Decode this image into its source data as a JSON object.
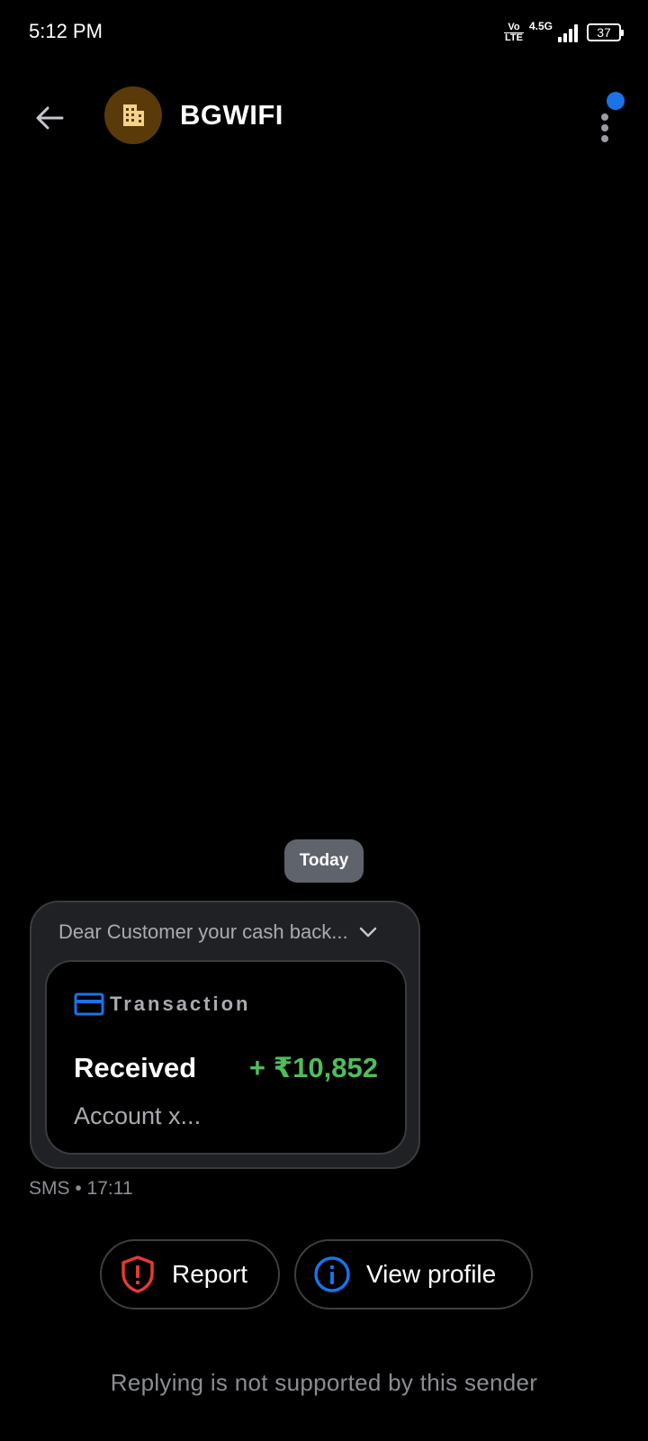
{
  "status_bar": {
    "time": "5:12 PM",
    "volte_top": "Vo",
    "volte_bottom": "LTE",
    "network": "4.5G",
    "battery": "37"
  },
  "header": {
    "back_icon": "arrow-left-icon",
    "avatar_icon": "building-icon",
    "avatar_color": "#5b3a0a",
    "sender_name": "BGWIFI",
    "more_icon": "more-vertical-icon",
    "notification_color": "#1a73e8"
  },
  "conversation": {
    "date_chip": "Today",
    "message": {
      "preview": "Dear Customer your cash back...",
      "expand_icon": "chevron-down-icon",
      "transaction": {
        "label": "Transaction",
        "icon": "credit-card-icon",
        "status": "Received",
        "amount": "+ ₹10,852",
        "account": "Account x...",
        "amount_color": "#4fbd5c"
      },
      "meta": "SMS • 17:11"
    }
  },
  "actions": {
    "report_label": "Report",
    "report_icon": "shield-alert-icon",
    "report_color": "#e53935",
    "view_profile_label": "View profile",
    "view_profile_icon": "info-circle-icon",
    "view_profile_color": "#1a73e8"
  },
  "footer": {
    "note": "Replying is not supported by this sender"
  }
}
